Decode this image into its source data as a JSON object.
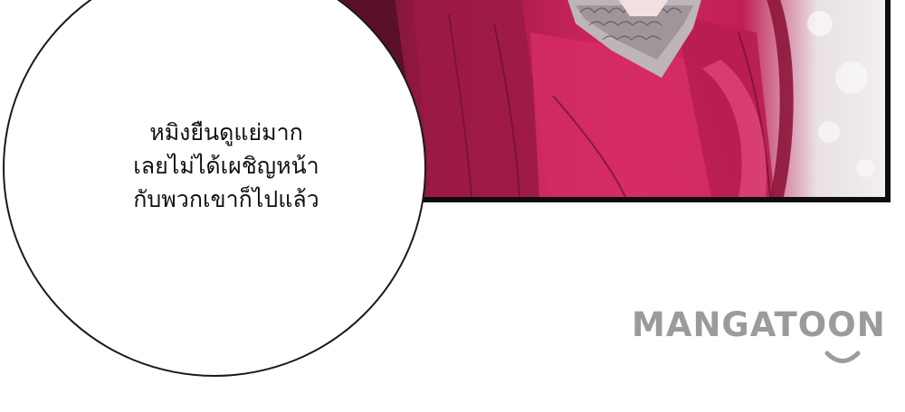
{
  "speech_bubble": {
    "lines": [
      "หมิงยืนดูแย่มาก",
      "เลยไม่ได้เผชิญหน้า",
      "กับพวกเขาก็ไปแล้ว"
    ]
  },
  "watermark": {
    "text": "MANGATOON"
  },
  "colors": {
    "dress": "#c01f55",
    "panel_border": "#0d0d0d",
    "watermark": "#9b9b9b"
  }
}
